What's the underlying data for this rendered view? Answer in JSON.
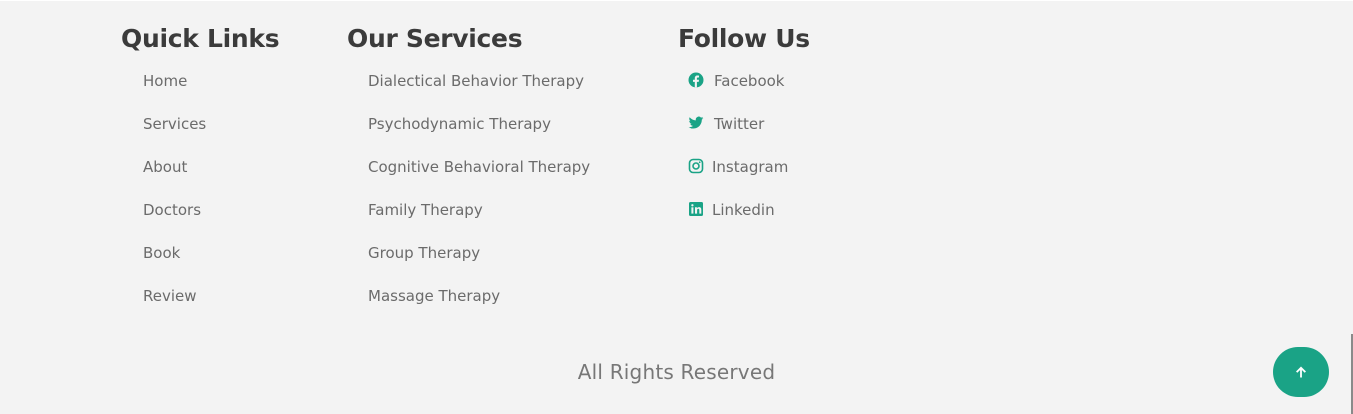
{
  "quick_links": {
    "heading": "Quick Links",
    "items": [
      {
        "label": "Home"
      },
      {
        "label": "Services"
      },
      {
        "label": "About"
      },
      {
        "label": "Doctors"
      },
      {
        "label": "Book"
      },
      {
        "label": "Review"
      }
    ]
  },
  "services": {
    "heading": "Our Services",
    "items": [
      {
        "label": "Dialectical Behavior Therapy"
      },
      {
        "label": "Psychodynamic Therapy"
      },
      {
        "label": "Cognitive Behavioral Therapy"
      },
      {
        "label": "Family Therapy"
      },
      {
        "label": "Group Therapy"
      },
      {
        "label": "Massage Therapy"
      }
    ]
  },
  "follow": {
    "heading": "Follow Us",
    "items": [
      {
        "label": "Facebook",
        "icon": "facebook-icon"
      },
      {
        "label": "Twitter",
        "icon": "twitter-icon"
      },
      {
        "label": "Instagram",
        "icon": "instagram-icon"
      },
      {
        "label": "Linkedin",
        "icon": "linkedin-icon"
      }
    ]
  },
  "footer": {
    "copyright": "All Rights Reserved"
  },
  "scroll_top": {
    "icon": "arrow-up-icon"
  },
  "colors": {
    "accent": "#1aa386",
    "heading": "#3b3b3b",
    "link": "#6b6b6b",
    "background": "#f3f3f3"
  }
}
